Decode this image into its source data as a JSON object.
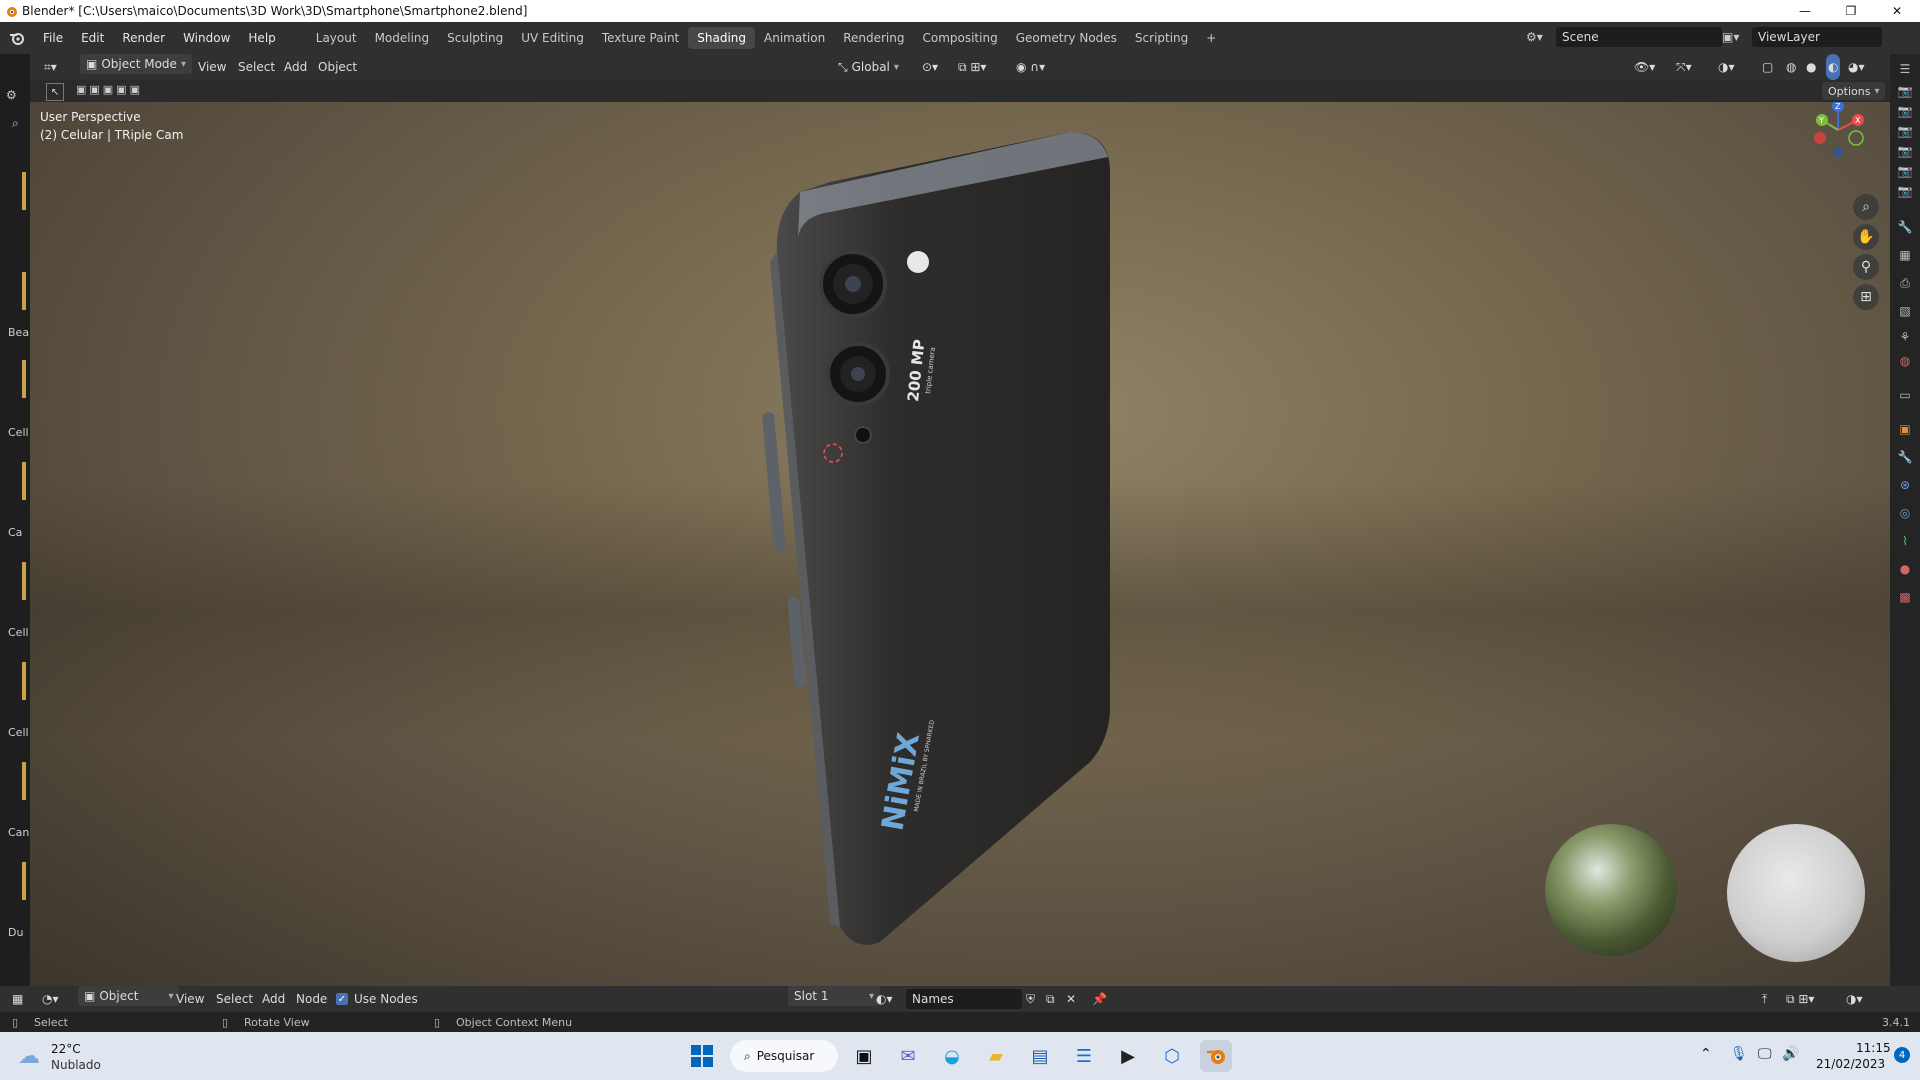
{
  "window": {
    "title": "Blender* [C:\\Users\\maico\\Documents\\3D Work\\3D\\Smartphone\\Smartphone2.blend]",
    "minimize": "—",
    "maximize": "❐",
    "close": "✕"
  },
  "menus": [
    "File",
    "Edit",
    "Render",
    "Window",
    "Help"
  ],
  "workspaces": [
    {
      "label": "Layout",
      "active": false
    },
    {
      "label": "Modeling",
      "active": false
    },
    {
      "label": "Sculpting",
      "active": false
    },
    {
      "label": "UV Editing",
      "active": false
    },
    {
      "label": "Texture Paint",
      "active": false
    },
    {
      "label": "Shading",
      "active": true
    },
    {
      "label": "Animation",
      "active": false
    },
    {
      "label": "Rendering",
      "active": false
    },
    {
      "label": "Compositing",
      "active": false
    },
    {
      "label": "Geometry Nodes",
      "active": false
    },
    {
      "label": "Scripting",
      "active": false
    }
  ],
  "add_workspace": "+",
  "scene": {
    "label": "Scene",
    "view_layer": "ViewLayer"
  },
  "viewport_header": {
    "mode": "Object Mode",
    "menus": [
      "View",
      "Select",
      "Add",
      "Object"
    ],
    "transform_orientation": "Global",
    "options": "Options"
  },
  "viewport": {
    "perspective": "User Perspective",
    "object_info": "(2) Celular | TRiple Cam",
    "phone_brand": "NiMiX",
    "phone_made_in": "MADE IN BRAZIL BY SPHARKED",
    "phone_camera_text": "200 MP",
    "phone_camera_sub": "triple camera",
    "gizmo_axes": [
      "X",
      "Y",
      "Z"
    ]
  },
  "left_strip_labels": [
    "Bea",
    "Cell",
    "Ca",
    "Cell",
    "Cell",
    "Can",
    "Du"
  ],
  "node_header": {
    "editor": "Object",
    "menus": [
      "View",
      "Select",
      "Add",
      "Node"
    ],
    "use_nodes_label": "Use Nodes",
    "use_nodes_checked": true,
    "slot": "Slot 1",
    "material_name": "Names"
  },
  "statusbar": {
    "select": "Select",
    "rotate": "Rotate View",
    "context_menu": "Object Context Menu",
    "version": "3.4.1"
  },
  "taskbar": {
    "weather_temp": "22°C",
    "weather_desc": "Nublado",
    "search": "Pesquisar",
    "time": "11:15",
    "date": "21/02/2023",
    "notification_count": "4",
    "accent": "#0067c0"
  }
}
